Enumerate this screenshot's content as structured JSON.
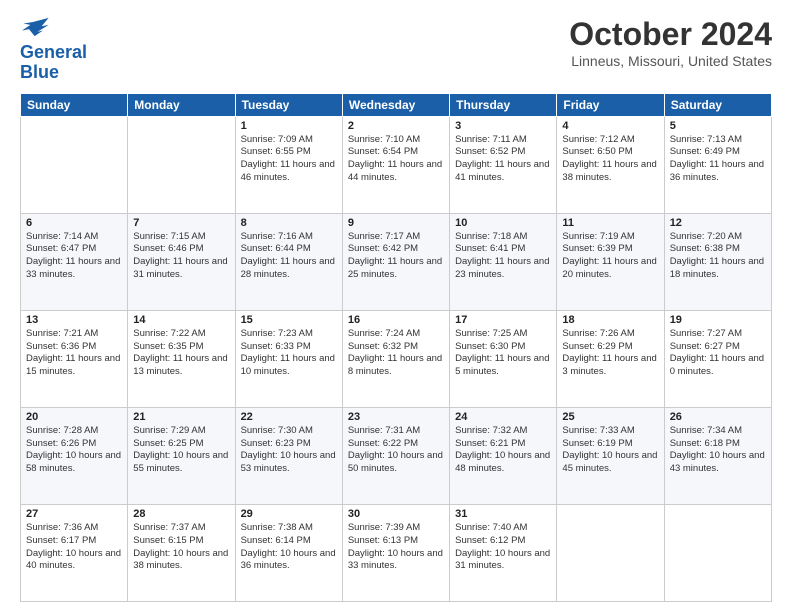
{
  "logo": {
    "line1": "General",
    "line2": "Blue"
  },
  "title": "October 2024",
  "subtitle": "Linneus, Missouri, United States",
  "headers": [
    "Sunday",
    "Monday",
    "Tuesday",
    "Wednesday",
    "Thursday",
    "Friday",
    "Saturday"
  ],
  "weeks": [
    [
      {
        "day": "",
        "info": ""
      },
      {
        "day": "",
        "info": ""
      },
      {
        "day": "1",
        "info": "Sunrise: 7:09 AM\nSunset: 6:55 PM\nDaylight: 11 hours and 46 minutes."
      },
      {
        "day": "2",
        "info": "Sunrise: 7:10 AM\nSunset: 6:54 PM\nDaylight: 11 hours and 44 minutes."
      },
      {
        "day": "3",
        "info": "Sunrise: 7:11 AM\nSunset: 6:52 PM\nDaylight: 11 hours and 41 minutes."
      },
      {
        "day": "4",
        "info": "Sunrise: 7:12 AM\nSunset: 6:50 PM\nDaylight: 11 hours and 38 minutes."
      },
      {
        "day": "5",
        "info": "Sunrise: 7:13 AM\nSunset: 6:49 PM\nDaylight: 11 hours and 36 minutes."
      }
    ],
    [
      {
        "day": "6",
        "info": "Sunrise: 7:14 AM\nSunset: 6:47 PM\nDaylight: 11 hours and 33 minutes."
      },
      {
        "day": "7",
        "info": "Sunrise: 7:15 AM\nSunset: 6:46 PM\nDaylight: 11 hours and 31 minutes."
      },
      {
        "day": "8",
        "info": "Sunrise: 7:16 AM\nSunset: 6:44 PM\nDaylight: 11 hours and 28 minutes."
      },
      {
        "day": "9",
        "info": "Sunrise: 7:17 AM\nSunset: 6:42 PM\nDaylight: 11 hours and 25 minutes."
      },
      {
        "day": "10",
        "info": "Sunrise: 7:18 AM\nSunset: 6:41 PM\nDaylight: 11 hours and 23 minutes."
      },
      {
        "day": "11",
        "info": "Sunrise: 7:19 AM\nSunset: 6:39 PM\nDaylight: 11 hours and 20 minutes."
      },
      {
        "day": "12",
        "info": "Sunrise: 7:20 AM\nSunset: 6:38 PM\nDaylight: 11 hours and 18 minutes."
      }
    ],
    [
      {
        "day": "13",
        "info": "Sunrise: 7:21 AM\nSunset: 6:36 PM\nDaylight: 11 hours and 15 minutes."
      },
      {
        "day": "14",
        "info": "Sunrise: 7:22 AM\nSunset: 6:35 PM\nDaylight: 11 hours and 13 minutes."
      },
      {
        "day": "15",
        "info": "Sunrise: 7:23 AM\nSunset: 6:33 PM\nDaylight: 11 hours and 10 minutes."
      },
      {
        "day": "16",
        "info": "Sunrise: 7:24 AM\nSunset: 6:32 PM\nDaylight: 11 hours and 8 minutes."
      },
      {
        "day": "17",
        "info": "Sunrise: 7:25 AM\nSunset: 6:30 PM\nDaylight: 11 hours and 5 minutes."
      },
      {
        "day": "18",
        "info": "Sunrise: 7:26 AM\nSunset: 6:29 PM\nDaylight: 11 hours and 3 minutes."
      },
      {
        "day": "19",
        "info": "Sunrise: 7:27 AM\nSunset: 6:27 PM\nDaylight: 11 hours and 0 minutes."
      }
    ],
    [
      {
        "day": "20",
        "info": "Sunrise: 7:28 AM\nSunset: 6:26 PM\nDaylight: 10 hours and 58 minutes."
      },
      {
        "day": "21",
        "info": "Sunrise: 7:29 AM\nSunset: 6:25 PM\nDaylight: 10 hours and 55 minutes."
      },
      {
        "day": "22",
        "info": "Sunrise: 7:30 AM\nSunset: 6:23 PM\nDaylight: 10 hours and 53 minutes."
      },
      {
        "day": "23",
        "info": "Sunrise: 7:31 AM\nSunset: 6:22 PM\nDaylight: 10 hours and 50 minutes."
      },
      {
        "day": "24",
        "info": "Sunrise: 7:32 AM\nSunset: 6:21 PM\nDaylight: 10 hours and 48 minutes."
      },
      {
        "day": "25",
        "info": "Sunrise: 7:33 AM\nSunset: 6:19 PM\nDaylight: 10 hours and 45 minutes."
      },
      {
        "day": "26",
        "info": "Sunrise: 7:34 AM\nSunset: 6:18 PM\nDaylight: 10 hours and 43 minutes."
      }
    ],
    [
      {
        "day": "27",
        "info": "Sunrise: 7:36 AM\nSunset: 6:17 PM\nDaylight: 10 hours and 40 minutes."
      },
      {
        "day": "28",
        "info": "Sunrise: 7:37 AM\nSunset: 6:15 PM\nDaylight: 10 hours and 38 minutes."
      },
      {
        "day": "29",
        "info": "Sunrise: 7:38 AM\nSunset: 6:14 PM\nDaylight: 10 hours and 36 minutes."
      },
      {
        "day": "30",
        "info": "Sunrise: 7:39 AM\nSunset: 6:13 PM\nDaylight: 10 hours and 33 minutes."
      },
      {
        "day": "31",
        "info": "Sunrise: 7:40 AM\nSunset: 6:12 PM\nDaylight: 10 hours and 31 minutes."
      },
      {
        "day": "",
        "info": ""
      },
      {
        "day": "",
        "info": ""
      }
    ]
  ]
}
